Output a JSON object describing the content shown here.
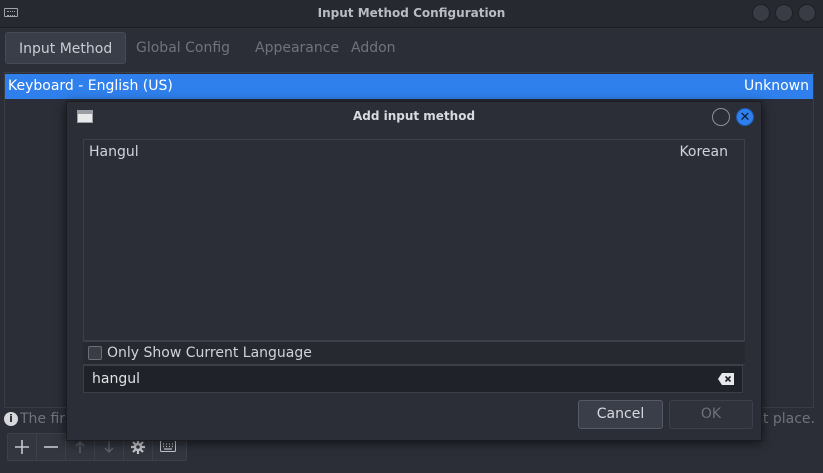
{
  "window": {
    "title": "Input Method Configuration",
    "icon": "keyboard-icon"
  },
  "tabs": [
    {
      "label": "Input Method",
      "active": true
    },
    {
      "label": "Global Config",
      "active": false
    },
    {
      "label": "Appearance",
      "active": false
    },
    {
      "label": "Addon",
      "active": false
    }
  ],
  "input_methods": [
    {
      "name": "Keyboard - English (US)",
      "language": "Unknown",
      "selected": true
    }
  ],
  "info": {
    "left_text": "The firs",
    "right_text": "st place."
  },
  "toolbar": {
    "icons": [
      "add-icon",
      "remove-icon",
      "move-up-icon",
      "move-down-icon",
      "configure-icon",
      "keyboard-layout-icon"
    ]
  },
  "dialog": {
    "title": "Add input method",
    "items": [
      {
        "name": "Hangul",
        "language": "Korean"
      }
    ],
    "only_current_language_label": "Only Show Current Language",
    "only_current_language_checked": false,
    "search_value": "hangul",
    "cancel_label": "Cancel",
    "ok_label": "OK"
  },
  "colors": {
    "accent": "#2f80ed",
    "background": "#2b2e37"
  }
}
